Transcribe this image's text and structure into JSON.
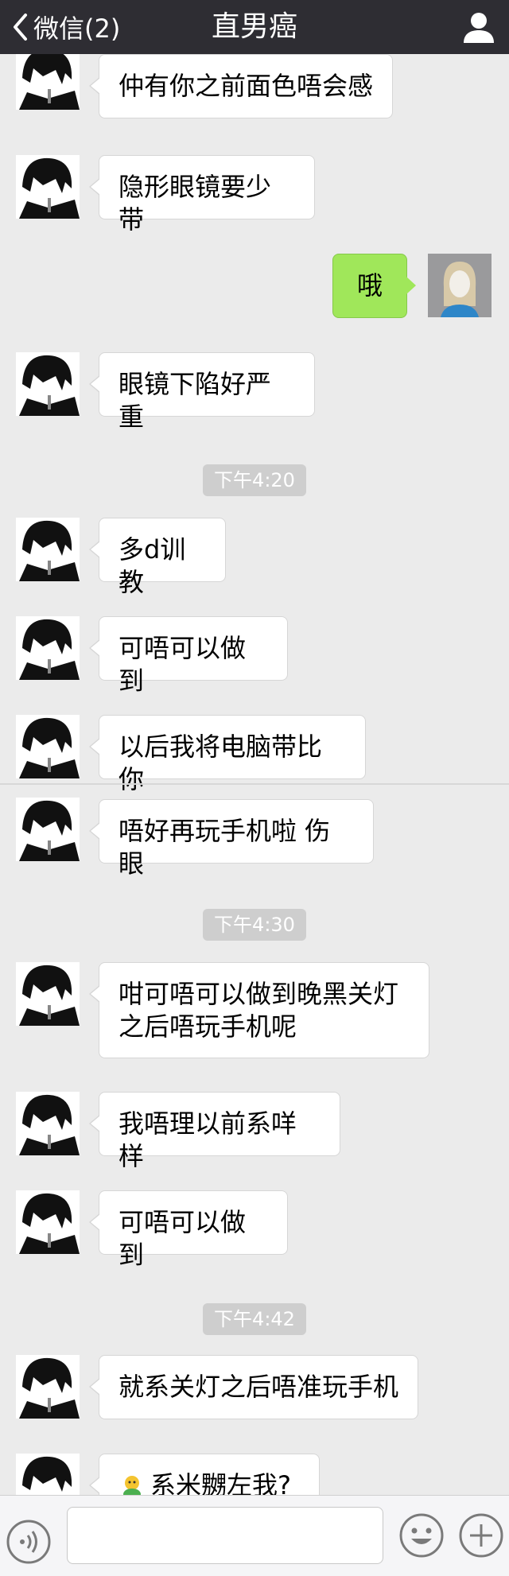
{
  "header": {
    "back_label": "微信(2)",
    "title": "直男癌"
  },
  "messages": [
    {
      "side": "in",
      "text": "仲有你之前面色唔会感"
    },
    {
      "side": "in",
      "text": "隐形眼镜要少带"
    },
    {
      "side": "out",
      "text": "哦"
    },
    {
      "side": "in",
      "text": "眼镜下陷好严重"
    },
    {
      "type": "time",
      "text": "下午4:20"
    },
    {
      "side": "in",
      "text": "多d训教"
    },
    {
      "side": "in",
      "text": "可唔可以做到"
    },
    {
      "side": "in",
      "text": "以后我将电脑带比你"
    },
    {
      "side": "in",
      "text": "唔好再玩手机啦 伤眼"
    },
    {
      "type": "time",
      "text": "下午4:30"
    },
    {
      "side": "in",
      "text": "咁可唔可以做到晚黑关灯之后唔玩手机呢"
    },
    {
      "side": "in",
      "text": "我唔理以前系咩样"
    },
    {
      "side": "in",
      "text": "可唔可以做到"
    },
    {
      "type": "time",
      "text": "下午4:42"
    },
    {
      "side": "in",
      "text": "就系关灯之后唔准玩手机"
    },
    {
      "side": "in",
      "text": "系米嬲左我?"
    }
  ],
  "colors": {
    "header_bg": "#2e2d33",
    "chat_bg": "#ebebeb",
    "outgoing_bubble": "#a0e75a",
    "incoming_bubble": "#ffffff"
  },
  "icons": {
    "back": "chevron-left-icon",
    "profile": "person-icon",
    "voice": "voice-icon",
    "emoji": "emoji-icon",
    "more": "plus-icon"
  }
}
